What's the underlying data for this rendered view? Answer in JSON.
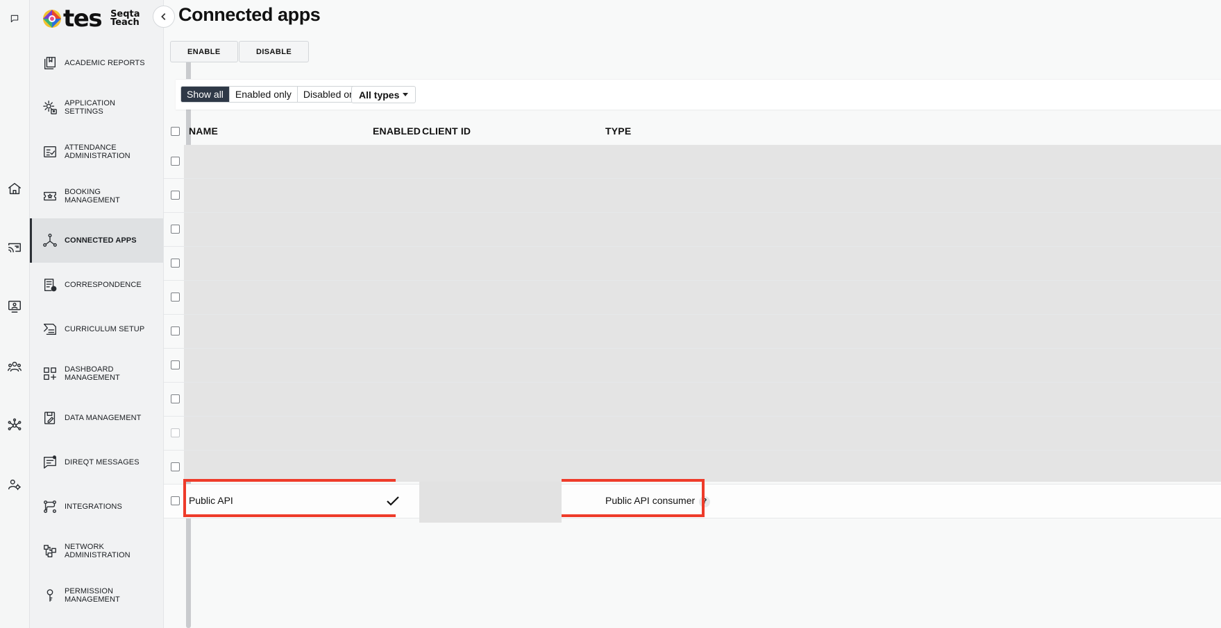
{
  "brand": {
    "wordmark": "tes",
    "product_line1": "Seqta",
    "product_line2": "Teach"
  },
  "rail": [
    {
      "icon": "chat-icon"
    },
    {
      "icon": "home-icon"
    },
    {
      "icon": "cast-icon"
    },
    {
      "icon": "presentation-icon"
    },
    {
      "icon": "people-icon"
    },
    {
      "icon": "network-icon"
    },
    {
      "icon": "user-settings-icon"
    }
  ],
  "sidebar": {
    "items": [
      {
        "label": "ACADEMIC REPORTS",
        "icon": "book-icon"
      },
      {
        "label": "APPLICATION SETTINGS",
        "icon": "gear-user-icon"
      },
      {
        "label": "ATTENDANCE ADMINISTRATION",
        "icon": "checklist-icon"
      },
      {
        "label": "BOOKING MANAGEMENT",
        "icon": "ticket-star-icon"
      },
      {
        "label": "CONNECTED APPS",
        "icon": "connected-nodes-icon",
        "active": true
      },
      {
        "label": "CORRESPONDENCE",
        "icon": "document-badge-icon"
      },
      {
        "label": "CURRICULUM SETUP",
        "icon": "curriculum-icon"
      },
      {
        "label": "DASHBOARD MANAGEMENT",
        "icon": "dashboard-grid-icon"
      },
      {
        "label": "DATA MANAGEMENT",
        "icon": "data-edit-icon"
      },
      {
        "label": "DIREQT MESSAGES",
        "icon": "message-icon"
      },
      {
        "label": "INTEGRATIONS",
        "icon": "integrations-icon"
      },
      {
        "label": "NETWORK ADMINISTRATION",
        "icon": "network-admin-icon"
      },
      {
        "label": "PERMISSION MANAGEMENT",
        "icon": "key-icon"
      }
    ]
  },
  "page": {
    "title": "Connected apps"
  },
  "toolbar": {
    "enable_label": "ENABLE",
    "disable_label": "DISABLE"
  },
  "filters": {
    "segments": [
      "Show all",
      "Enabled only",
      "Disabled only"
    ],
    "active_segment": "Show all",
    "type_dropdown": "All types"
  },
  "table": {
    "columns": {
      "name": "NAME",
      "enabled": "ENABLED",
      "client_id": "CLIENT ID",
      "type": "TYPE"
    },
    "redacted_row_count": 10,
    "visible_row": {
      "name": "Public API",
      "enabled": true,
      "type": "Public API consumer",
      "help": "?"
    }
  },
  "colors": {
    "highlight": "#ee3b2a",
    "active_segment": "#2f3947"
  }
}
